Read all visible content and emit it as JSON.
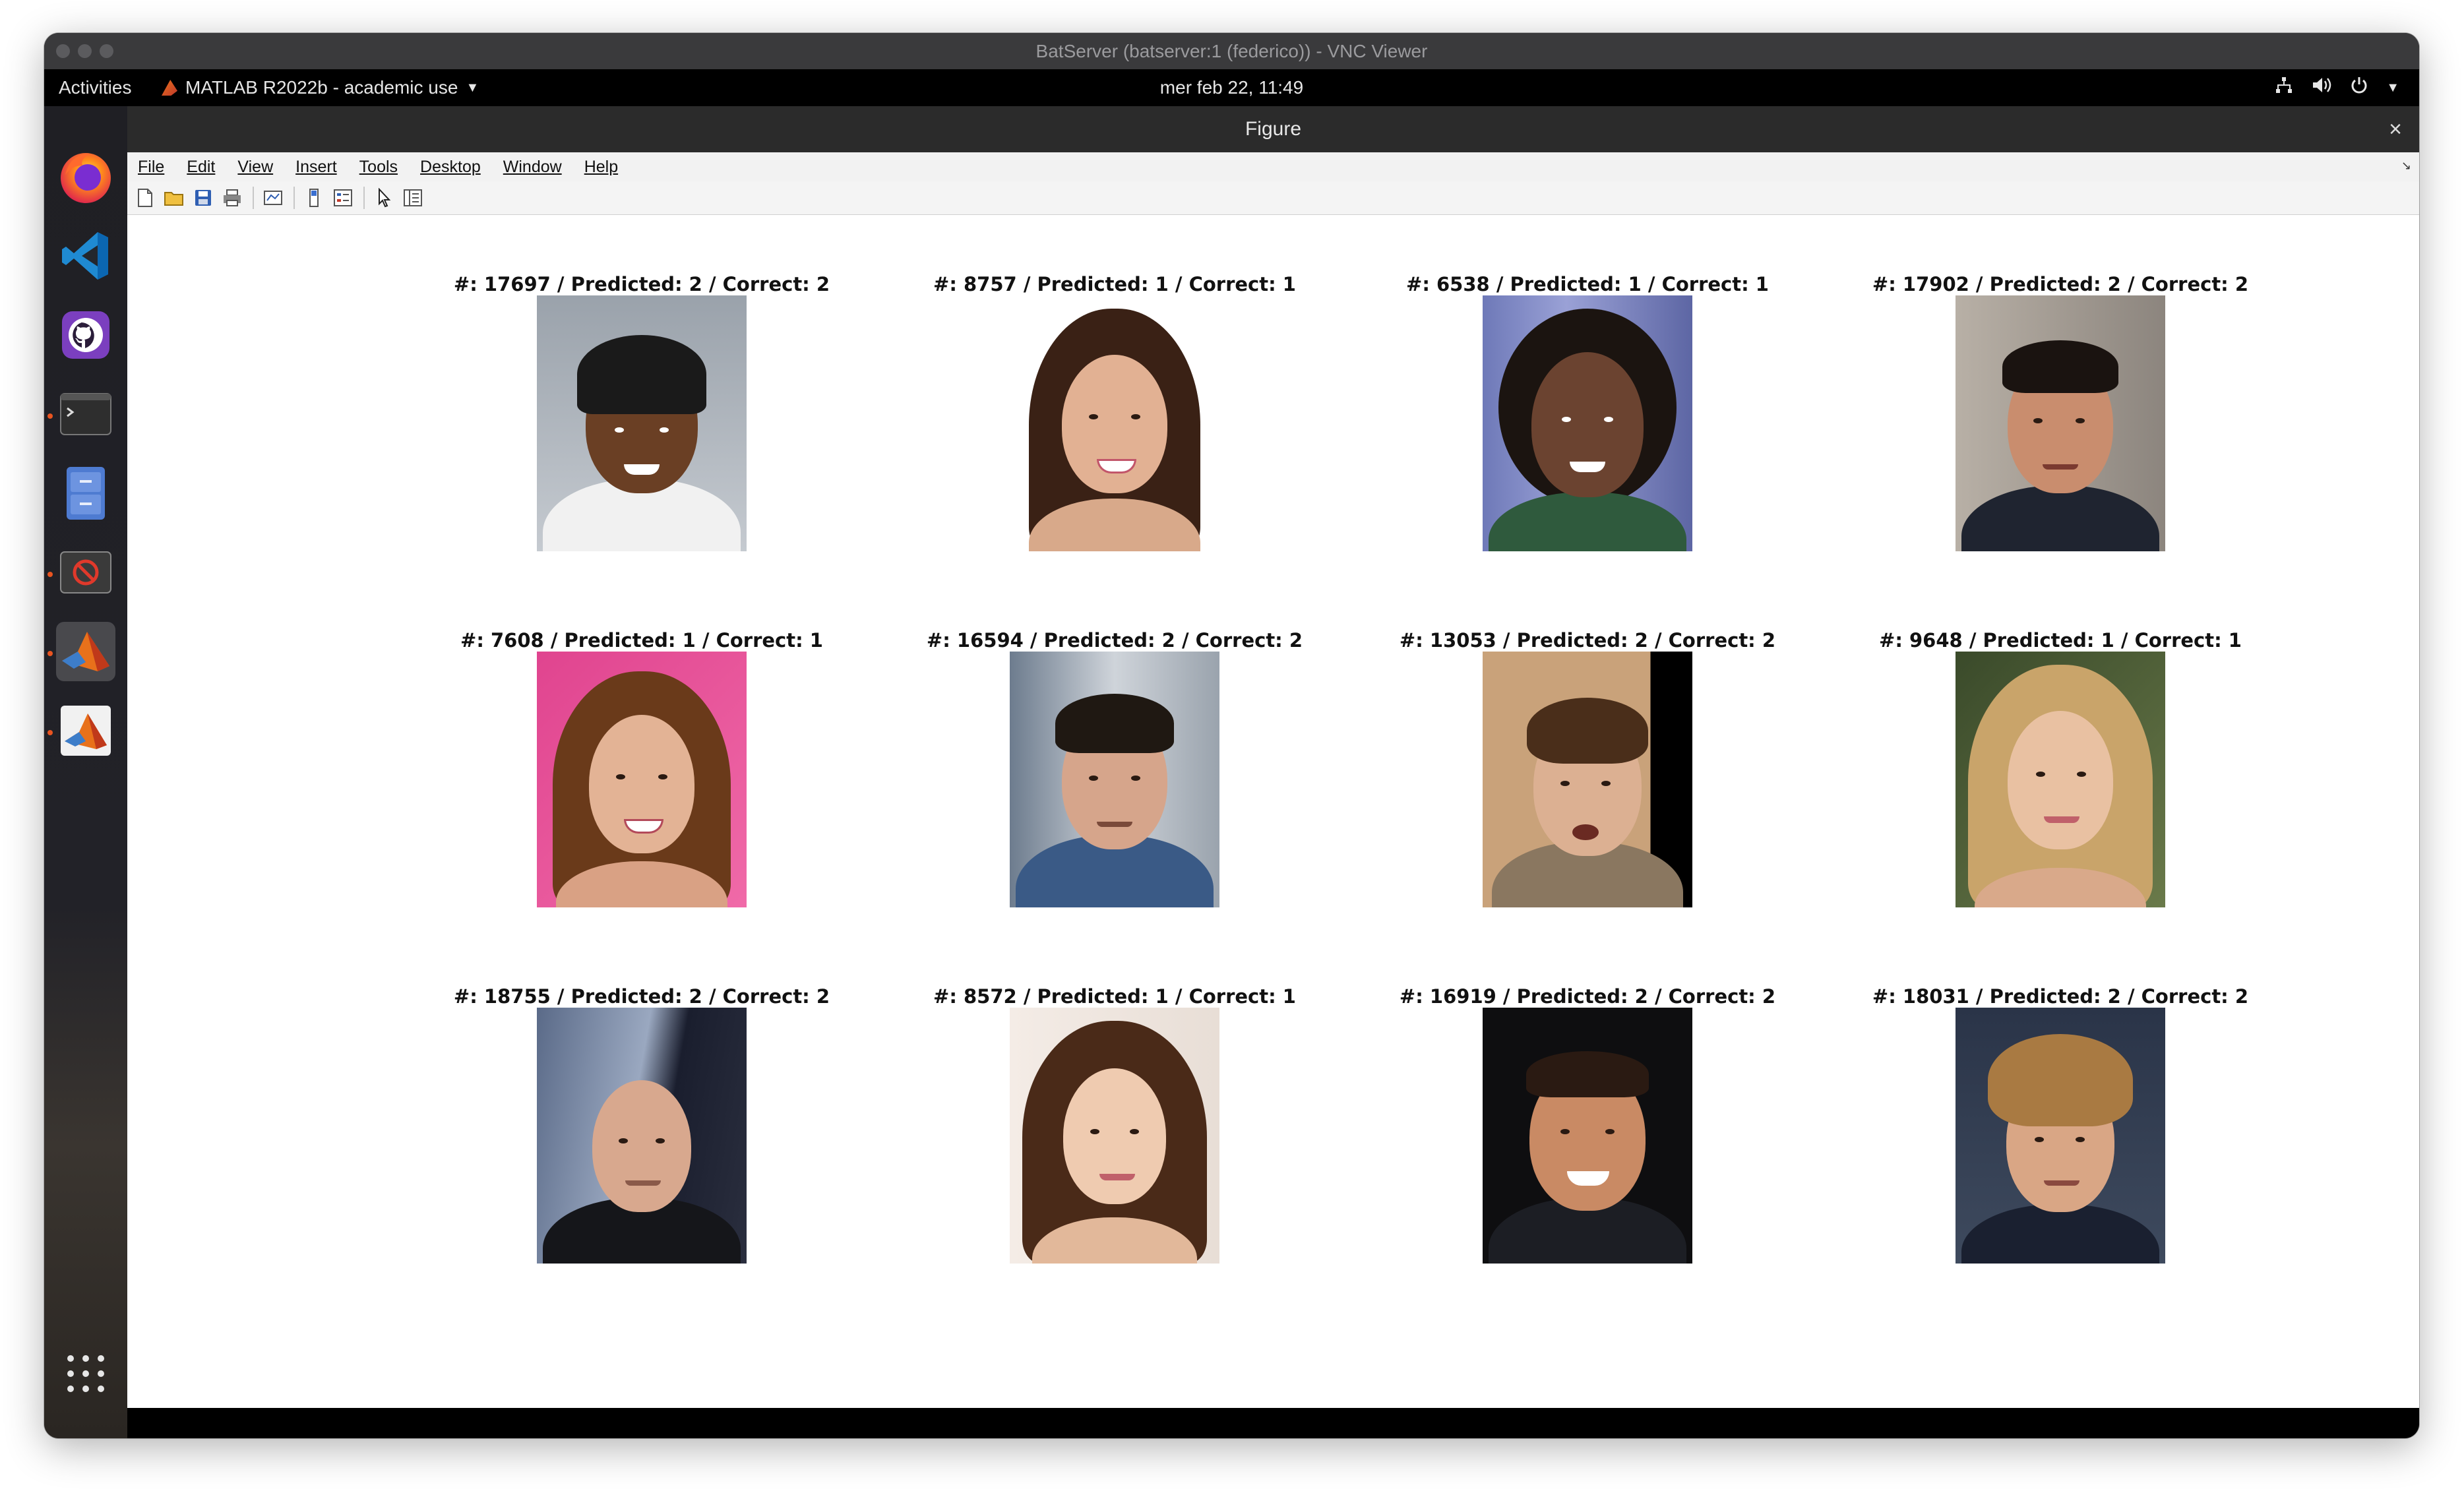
{
  "vnc": {
    "window_title": "BatServer (batserver:1 (federico)) - VNC Viewer"
  },
  "topbar": {
    "activities": "Activities",
    "app_menu": "MATLAB R2022b - academic use",
    "clock": "mer feb 22, 11:49"
  },
  "dock": {
    "items": [
      {
        "icon": "firefox-icon"
      },
      {
        "icon": "vscode-icon"
      },
      {
        "icon": "github-desktop-icon"
      },
      {
        "icon": "terminal-icon"
      },
      {
        "icon": "file-cabinet-icon"
      },
      {
        "icon": "blocked-app-icon"
      },
      {
        "icon": "matlab-icon"
      },
      {
        "icon": "matlab-icon"
      },
      {
        "icon": "show-apps-grid-icon"
      }
    ]
  },
  "figure": {
    "title": "Figure",
    "close": "×",
    "menu": {
      "file": "File",
      "edit": "Edit",
      "view": "View",
      "insert": "Insert",
      "tools": "Tools",
      "desktop": "Desktop",
      "window": "Window",
      "help": "Help"
    },
    "subplots": [
      {
        "title": "#: 17697 / Predicted: 2 / Correct: 2"
      },
      {
        "title": "#: 8757 / Predicted: 1 / Correct: 1"
      },
      {
        "title": "#: 6538 / Predicted: 1 / Correct: 1"
      },
      {
        "title": "#: 17902 / Predicted: 2 / Correct: 2"
      },
      {
        "title": "#: 7608 / Predicted: 1 / Correct: 1"
      },
      {
        "title": "#: 16594 / Predicted: 2 / Correct: 2"
      },
      {
        "title": "#: 13053 / Predicted: 2 / Correct: 2"
      },
      {
        "title": "#: 9648 / Predicted: 1 / Correct: 1"
      },
      {
        "title": "#: 18755 / Predicted: 2 / Correct: 2"
      },
      {
        "title": "#: 8572 / Predicted: 1 / Correct: 1"
      },
      {
        "title": "#: 16919 / Predicted: 2 / Correct: 2"
      },
      {
        "title": "#: 18031 / Predicted: 2 / Correct: 2"
      }
    ]
  }
}
